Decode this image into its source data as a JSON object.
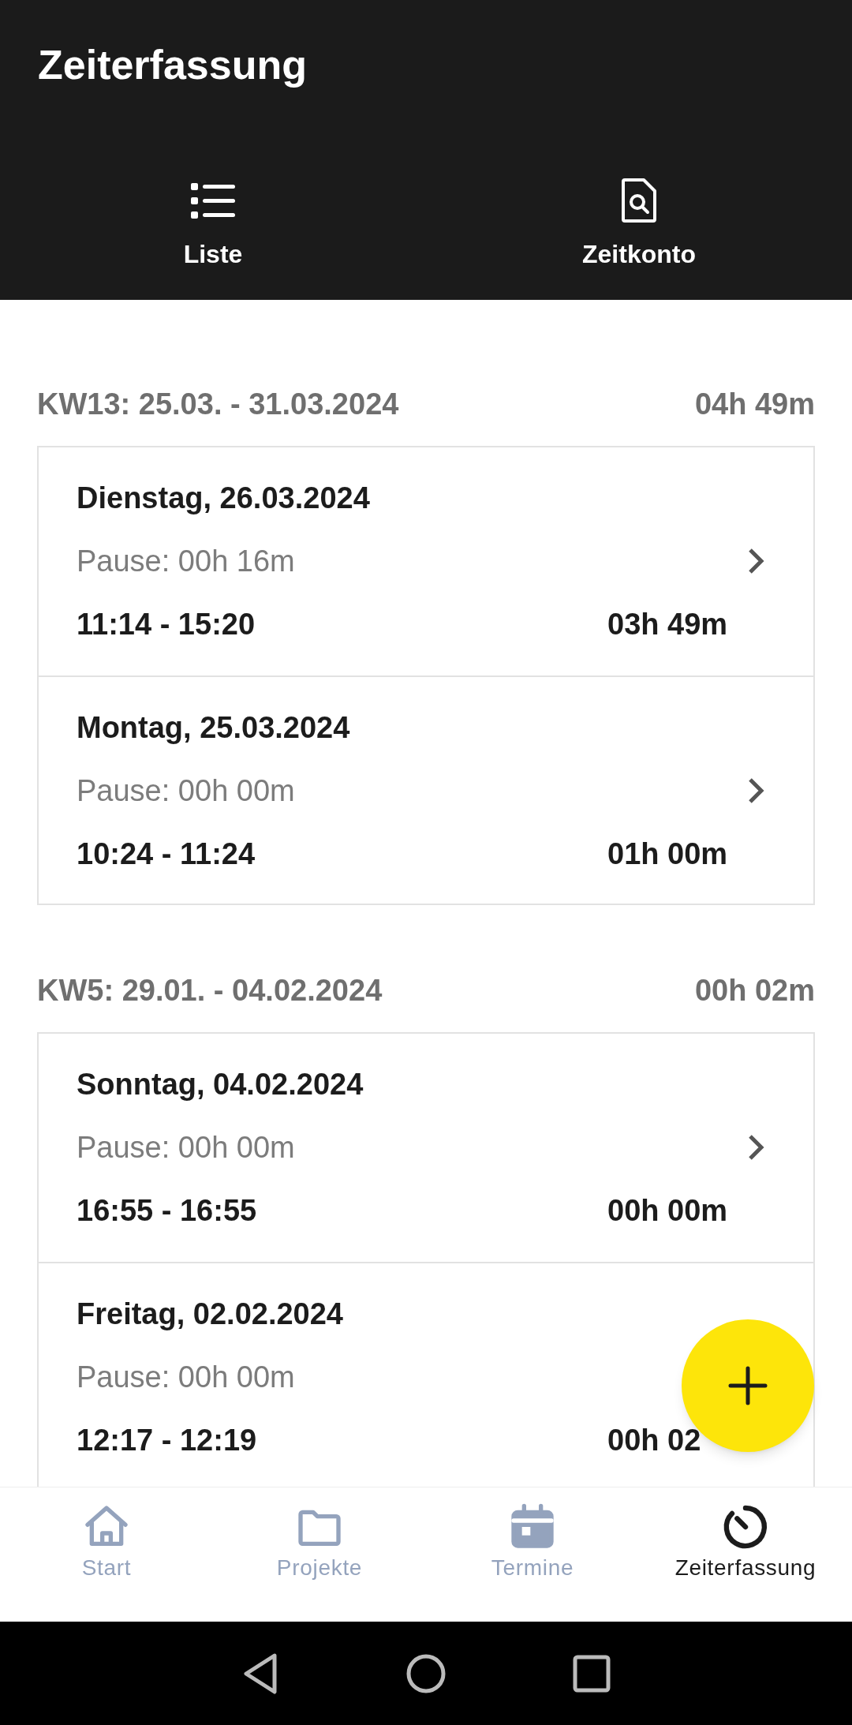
{
  "app_bar": {
    "title": "Zeiterfassung"
  },
  "tabs": [
    {
      "label": "Liste",
      "kind": "list"
    },
    {
      "label": "Zeitkonto",
      "kind": "doc"
    }
  ],
  "weeks": [
    {
      "label": "KW13: 25.03. - 31.03.2024",
      "total": "04h 49m",
      "entries": [
        {
          "date": "Dienstag, 26.03.2024",
          "pause": "Pause: 00h 16m",
          "time": "11:14 - 15:20",
          "duration": "03h 49m"
        },
        {
          "date": "Montag, 25.03.2024",
          "pause": "Pause: 00h 00m",
          "time": "10:24 - 11:24",
          "duration": "01h 00m"
        }
      ]
    },
    {
      "label": "KW5: 29.01. - 04.02.2024",
      "total": "00h 02m",
      "entries": [
        {
          "date": "Sonntag, 04.02.2024",
          "pause": "Pause: 00h 00m",
          "time": "16:55 - 16:55",
          "duration": "00h 00m"
        },
        {
          "date": "Freitag, 02.02.2024",
          "pause": "Pause: 00h 00m",
          "time": "12:17 - 12:19",
          "duration": "00h 02"
        }
      ]
    }
  ],
  "bottom_nav": [
    {
      "label": "Start",
      "kind": "home",
      "selected": false
    },
    {
      "label": "Projekte",
      "kind": "folder",
      "selected": false
    },
    {
      "label": "Termine",
      "kind": "calendar",
      "selected": false
    },
    {
      "label": "Zeiterfassung",
      "kind": "timer",
      "selected": true
    }
  ]
}
